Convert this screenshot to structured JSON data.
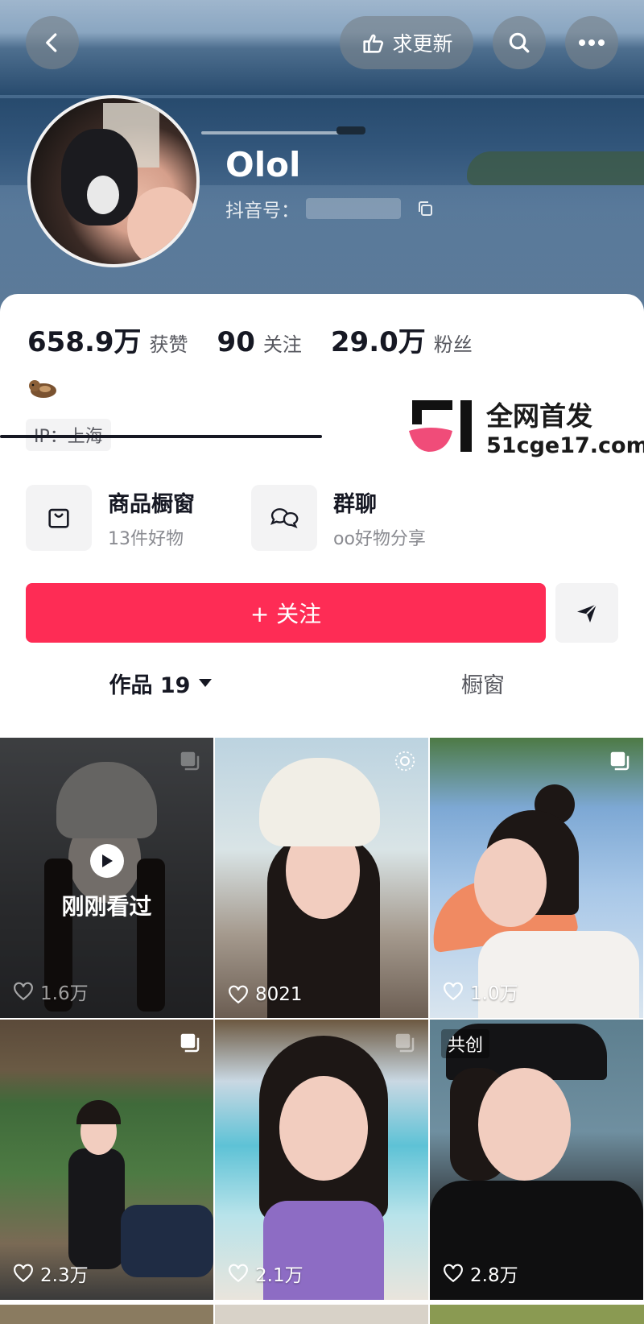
{
  "header": {
    "update_label": "求更新"
  },
  "profile": {
    "username": "Olol",
    "douyin_id_label": "抖音号："
  },
  "stats": [
    {
      "num": "658.9万",
      "label": "获赞"
    },
    {
      "num": "90",
      "label": "关注"
    },
    {
      "num": "29.0万",
      "label": "粉丝"
    }
  ],
  "ip_tag": "IP：上海",
  "watermark": {
    "line1": "全网首发",
    "line2": "51cge17.com"
  },
  "entries": {
    "shop": {
      "title": "商品橱窗",
      "sub": "13件好物"
    },
    "group": {
      "title": "群聊",
      "sub": "oo好物分享"
    }
  },
  "follow_label": "+ 关注",
  "tabs": {
    "works": "作品 19",
    "showcase": "橱窗"
  },
  "grid": {
    "recent_text": "刚刚看过",
    "cocreate": "共创",
    "tiles": [
      {
        "likes": "1.6万"
      },
      {
        "likes": "8021"
      },
      {
        "likes": "1.0万"
      },
      {
        "likes": "2.3万"
      },
      {
        "likes": "2.1万"
      },
      {
        "likes": "2.8万"
      }
    ]
  },
  "colors": {
    "accent": "#fe2c55",
    "text": "#161823",
    "muted": "#57585f"
  }
}
